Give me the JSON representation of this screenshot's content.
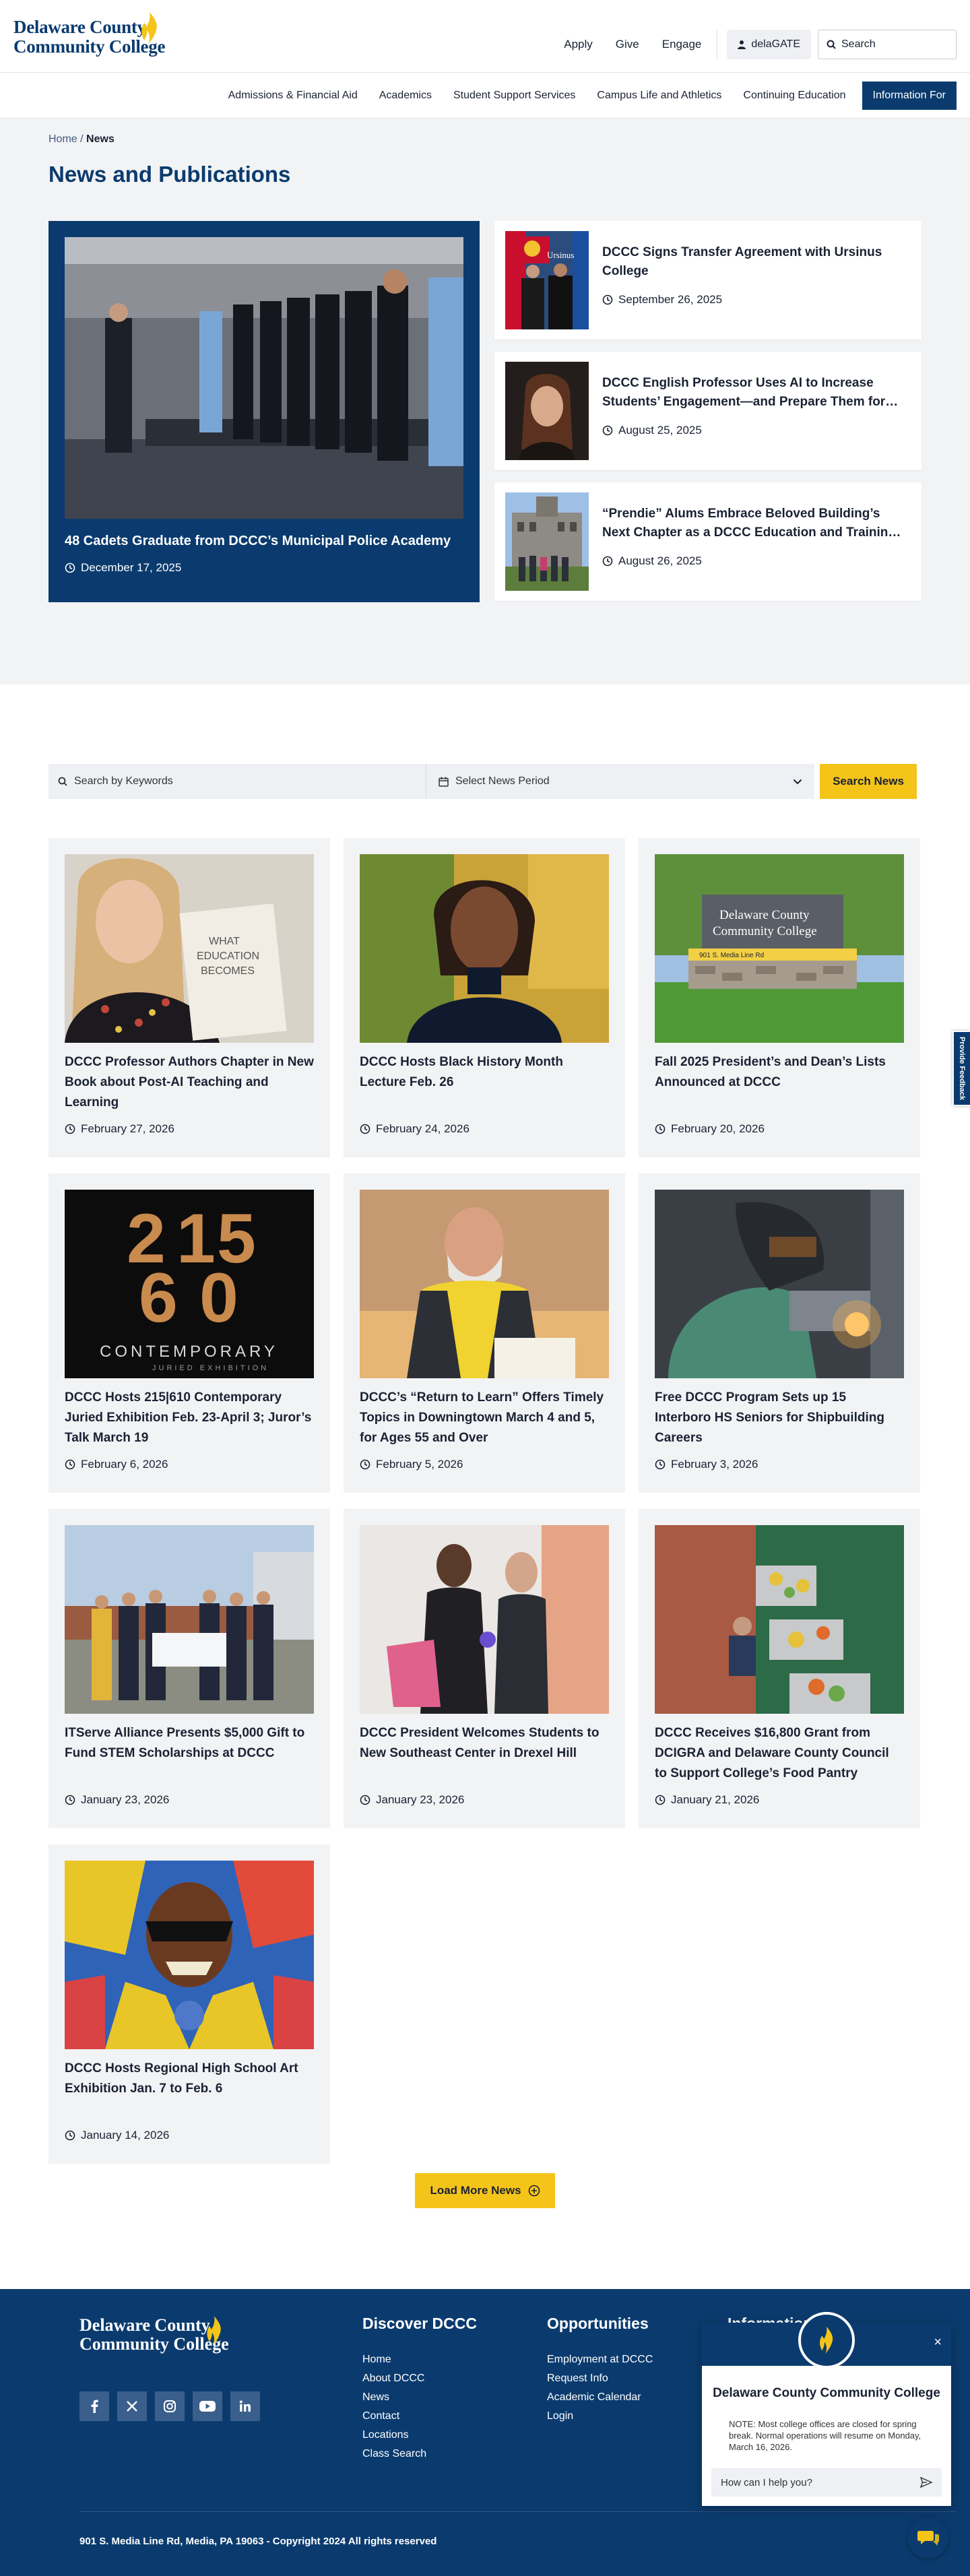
{
  "brand": {
    "line1": "Delaware County",
    "line2": "Community College"
  },
  "utility": {
    "apply": "Apply",
    "give": "Give",
    "engage": "Engage",
    "delagate": "delaGATE",
    "search": "Search"
  },
  "nav": {
    "items": [
      "Admissions & Financial Aid",
      "Academics",
      "Student Support Services",
      "Campus Life and Athletics",
      "Continuing Education"
    ],
    "cta": "Information For"
  },
  "breadcrumb": {
    "home": "Home",
    "sep": "/",
    "current": "News"
  },
  "page_title": "News and Publications",
  "featured": {
    "title": "48 Cadets Graduate from DCCC’s Municipal Police Academy",
    "date": "December 17, 2025"
  },
  "side_stories": [
    {
      "title": "DCCC Signs Transfer Agreement with Ursinus College",
      "date": "September 26, 2025"
    },
    {
      "title": "DCCC English Professor Uses AI to Increase Students’ Engagement—and Prepare Them for…",
      "date": "August 25, 2025"
    },
    {
      "title": "“Prendie” Alums Embrace Beloved Building’s Next Chapter as a DCCC Education and Trainin…",
      "date": "August 26, 2025"
    }
  ],
  "filter": {
    "keywords_placeholder": "Search by Keywords",
    "period_placeholder": "Select News Period",
    "button": "Search News"
  },
  "articles": [
    {
      "title": "DCCC Professor Authors Chapter in New Book about Post-AI Teaching and Learning",
      "date": "February 27, 2026"
    },
    {
      "title": "DCCC Hosts Black History Month Lecture Feb. 26",
      "date": "February 24, 2026"
    },
    {
      "title": "Fall 2025 President’s and Dean’s Lists Announced at DCCC",
      "date": "February 20, 2026"
    },
    {
      "title": "DCCC Hosts 215|610 Contemporary Juried Exhibition Feb. 23-April 3; Juror’s Talk March 19",
      "date": "February 6, 2026"
    },
    {
      "title": "DCCC’s “Return to Learn” Offers Timely Topics in Downingtown March 4 and 5, for Ages 55 and Over",
      "date": "February 5, 2026"
    },
    {
      "title": "Free DCCC Program Sets up 15 Interboro HS Seniors for Shipbuilding Careers",
      "date": "February 3, 2026"
    },
    {
      "title": "ITServe Alliance Presents $5,000 Gift to Fund STEM Scholarships at DCCC",
      "date": "January 23, 2026"
    },
    {
      "title": "DCCC President Welcomes Students to New Southeast Center in Drexel Hill",
      "date": "January 23, 2026"
    },
    {
      "title": "DCCC Receives $16,800 Grant from DCIGRA and Delaware County Council to Support College’s Food Pantry",
      "date": "January 21, 2026"
    },
    {
      "title": "DCCC Hosts Regional High School Art Exhibition Jan. 7 to Feb. 6",
      "date": "January 14, 2026"
    }
  ],
  "image_text": {
    "book": [
      "WHAT",
      "EDUCATION",
      "BECOMES"
    ],
    "sign": [
      "Delaware County",
      "Community College"
    ],
    "sign_plate": "901 S. Media Line Rd",
    "exhibit_numbers": [
      "2",
      "1",
      "5",
      "6",
      "0"
    ],
    "exhibit_word": "CONTEMPORARY",
    "exhibit_sub": "JURIED EXHIBITION",
    "flag": "Ursinus"
  },
  "load_more": "Load More News",
  "footer": {
    "discover": {
      "heading": "Discover DCCC",
      "links": [
        "Home",
        "About DCCC",
        "News",
        "Contact",
        "Locations",
        "Class Search"
      ]
    },
    "opportunities": {
      "heading": "Opportunities",
      "links": [
        "Employment at DCCC",
        "Request Info",
        "Academic Calendar",
        "Login"
      ]
    },
    "info_heading": "Information",
    "address": "901 S. Media Line Rd, Media, PA 19063 - Copyright 2024 All rights reserved"
  },
  "chat": {
    "title": "Delaware County Community College",
    "note": "NOTE: Most college offices are closed for spring break. Normal operations will resume on Monday, March 16, 2026.",
    "placeholder": "How can I help you?",
    "close": "×"
  },
  "feedback": "Provide Feedback",
  "colors": {
    "navy": "#0b3b6e",
    "gold": "#f5c419",
    "light_bg": "#f2f3f5"
  }
}
